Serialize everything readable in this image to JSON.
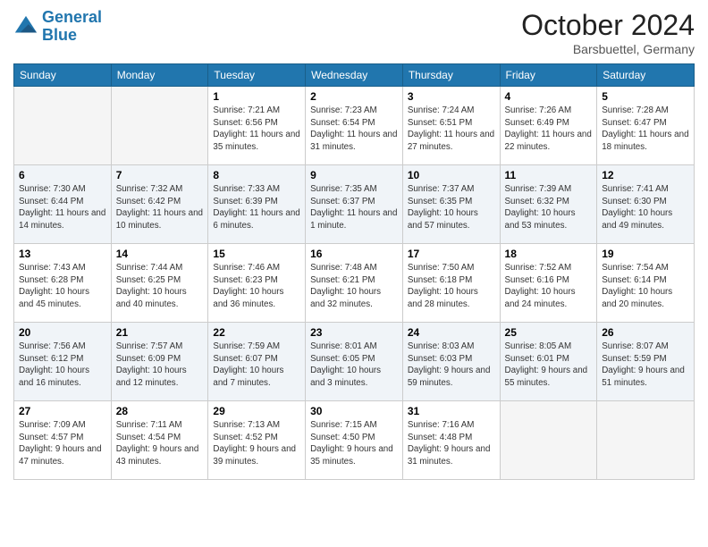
{
  "header": {
    "logo_line1": "General",
    "logo_line2": "Blue",
    "month": "October 2024",
    "location": "Barsbuettel, Germany"
  },
  "weekdays": [
    "Sunday",
    "Monday",
    "Tuesday",
    "Wednesday",
    "Thursday",
    "Friday",
    "Saturday"
  ],
  "weeks": [
    [
      {
        "day": null
      },
      {
        "day": null
      },
      {
        "day": "1",
        "sunrise": "Sunrise: 7:21 AM",
        "sunset": "Sunset: 6:56 PM",
        "daylight": "Daylight: 11 hours and 35 minutes."
      },
      {
        "day": "2",
        "sunrise": "Sunrise: 7:23 AM",
        "sunset": "Sunset: 6:54 PM",
        "daylight": "Daylight: 11 hours and 31 minutes."
      },
      {
        "day": "3",
        "sunrise": "Sunrise: 7:24 AM",
        "sunset": "Sunset: 6:51 PM",
        "daylight": "Daylight: 11 hours and 27 minutes."
      },
      {
        "day": "4",
        "sunrise": "Sunrise: 7:26 AM",
        "sunset": "Sunset: 6:49 PM",
        "daylight": "Daylight: 11 hours and 22 minutes."
      },
      {
        "day": "5",
        "sunrise": "Sunrise: 7:28 AM",
        "sunset": "Sunset: 6:47 PM",
        "daylight": "Daylight: 11 hours and 18 minutes."
      }
    ],
    [
      {
        "day": "6",
        "sunrise": "Sunrise: 7:30 AM",
        "sunset": "Sunset: 6:44 PM",
        "daylight": "Daylight: 11 hours and 14 minutes."
      },
      {
        "day": "7",
        "sunrise": "Sunrise: 7:32 AM",
        "sunset": "Sunset: 6:42 PM",
        "daylight": "Daylight: 11 hours and 10 minutes."
      },
      {
        "day": "8",
        "sunrise": "Sunrise: 7:33 AM",
        "sunset": "Sunset: 6:39 PM",
        "daylight": "Daylight: 11 hours and 6 minutes."
      },
      {
        "day": "9",
        "sunrise": "Sunrise: 7:35 AM",
        "sunset": "Sunset: 6:37 PM",
        "daylight": "Daylight: 11 hours and 1 minute."
      },
      {
        "day": "10",
        "sunrise": "Sunrise: 7:37 AM",
        "sunset": "Sunset: 6:35 PM",
        "daylight": "Daylight: 10 hours and 57 minutes."
      },
      {
        "day": "11",
        "sunrise": "Sunrise: 7:39 AM",
        "sunset": "Sunset: 6:32 PM",
        "daylight": "Daylight: 10 hours and 53 minutes."
      },
      {
        "day": "12",
        "sunrise": "Sunrise: 7:41 AM",
        "sunset": "Sunset: 6:30 PM",
        "daylight": "Daylight: 10 hours and 49 minutes."
      }
    ],
    [
      {
        "day": "13",
        "sunrise": "Sunrise: 7:43 AM",
        "sunset": "Sunset: 6:28 PM",
        "daylight": "Daylight: 10 hours and 45 minutes."
      },
      {
        "day": "14",
        "sunrise": "Sunrise: 7:44 AM",
        "sunset": "Sunset: 6:25 PM",
        "daylight": "Daylight: 10 hours and 40 minutes."
      },
      {
        "day": "15",
        "sunrise": "Sunrise: 7:46 AM",
        "sunset": "Sunset: 6:23 PM",
        "daylight": "Daylight: 10 hours and 36 minutes."
      },
      {
        "day": "16",
        "sunrise": "Sunrise: 7:48 AM",
        "sunset": "Sunset: 6:21 PM",
        "daylight": "Daylight: 10 hours and 32 minutes."
      },
      {
        "day": "17",
        "sunrise": "Sunrise: 7:50 AM",
        "sunset": "Sunset: 6:18 PM",
        "daylight": "Daylight: 10 hours and 28 minutes."
      },
      {
        "day": "18",
        "sunrise": "Sunrise: 7:52 AM",
        "sunset": "Sunset: 6:16 PM",
        "daylight": "Daylight: 10 hours and 24 minutes."
      },
      {
        "day": "19",
        "sunrise": "Sunrise: 7:54 AM",
        "sunset": "Sunset: 6:14 PM",
        "daylight": "Daylight: 10 hours and 20 minutes."
      }
    ],
    [
      {
        "day": "20",
        "sunrise": "Sunrise: 7:56 AM",
        "sunset": "Sunset: 6:12 PM",
        "daylight": "Daylight: 10 hours and 16 minutes."
      },
      {
        "day": "21",
        "sunrise": "Sunrise: 7:57 AM",
        "sunset": "Sunset: 6:09 PM",
        "daylight": "Daylight: 10 hours and 12 minutes."
      },
      {
        "day": "22",
        "sunrise": "Sunrise: 7:59 AM",
        "sunset": "Sunset: 6:07 PM",
        "daylight": "Daylight: 10 hours and 7 minutes."
      },
      {
        "day": "23",
        "sunrise": "Sunrise: 8:01 AM",
        "sunset": "Sunset: 6:05 PM",
        "daylight": "Daylight: 10 hours and 3 minutes."
      },
      {
        "day": "24",
        "sunrise": "Sunrise: 8:03 AM",
        "sunset": "Sunset: 6:03 PM",
        "daylight": "Daylight: 9 hours and 59 minutes."
      },
      {
        "day": "25",
        "sunrise": "Sunrise: 8:05 AM",
        "sunset": "Sunset: 6:01 PM",
        "daylight": "Daylight: 9 hours and 55 minutes."
      },
      {
        "day": "26",
        "sunrise": "Sunrise: 8:07 AM",
        "sunset": "Sunset: 5:59 PM",
        "daylight": "Daylight: 9 hours and 51 minutes."
      }
    ],
    [
      {
        "day": "27",
        "sunrise": "Sunrise: 7:09 AM",
        "sunset": "Sunset: 4:57 PM",
        "daylight": "Daylight: 9 hours and 47 minutes."
      },
      {
        "day": "28",
        "sunrise": "Sunrise: 7:11 AM",
        "sunset": "Sunset: 4:54 PM",
        "daylight": "Daylight: 9 hours and 43 minutes."
      },
      {
        "day": "29",
        "sunrise": "Sunrise: 7:13 AM",
        "sunset": "Sunset: 4:52 PM",
        "daylight": "Daylight: 9 hours and 39 minutes."
      },
      {
        "day": "30",
        "sunrise": "Sunrise: 7:15 AM",
        "sunset": "Sunset: 4:50 PM",
        "daylight": "Daylight: 9 hours and 35 minutes."
      },
      {
        "day": "31",
        "sunrise": "Sunrise: 7:16 AM",
        "sunset": "Sunset: 4:48 PM",
        "daylight": "Daylight: 9 hours and 31 minutes."
      },
      {
        "day": null
      },
      {
        "day": null
      }
    ]
  ]
}
